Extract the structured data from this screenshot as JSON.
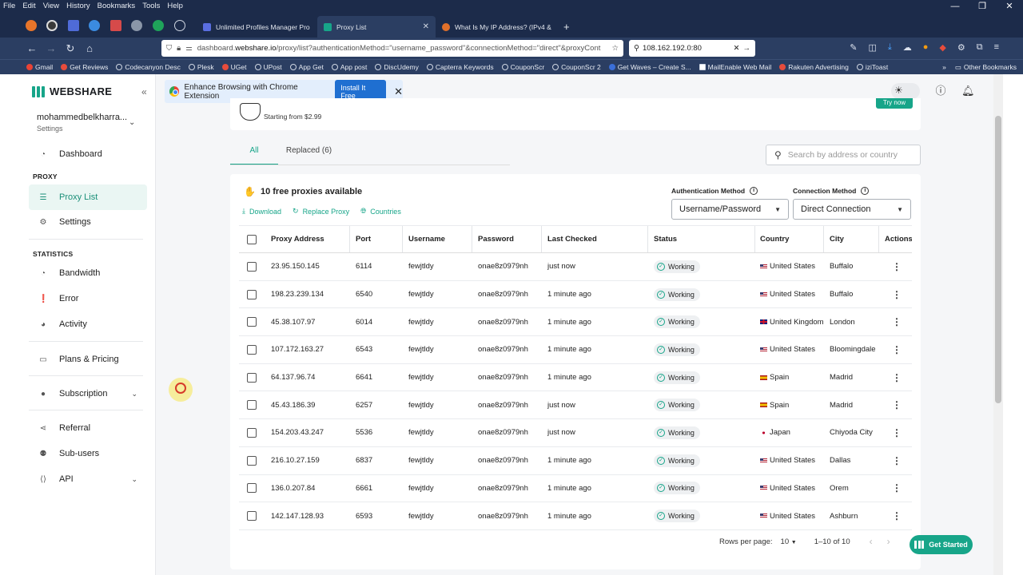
{
  "menubar": {
    "items": [
      "File",
      "Edit",
      "View",
      "History",
      "Bookmarks",
      "Tools",
      "Help"
    ]
  },
  "tabs": [
    {
      "title": "Unlimited Profiles Manager Pro",
      "active": false
    },
    {
      "title": "Proxy List",
      "active": true
    },
    {
      "title": "What Is My IP Address? (IPv4 &",
      "active": false
    }
  ],
  "newtab": "+",
  "url": {
    "prefix": "dashboard.",
    "domain": "webshare.io",
    "path": "/proxy/list?authenticationMethod=\"username_password\"&connectionMethod=\"direct\"&proxyCont"
  },
  "searchbar": {
    "value": "108.162.192.0:80"
  },
  "bookmarks": [
    "Gmail",
    "Get Reviews",
    "Codecanyon Desc",
    "Plesk",
    "UGet",
    "UPost",
    "App Get",
    "App post",
    "DiscUdemy",
    "Capterra Keywords",
    "CouponScr",
    "CouponScr 2",
    "Get Waves – Create S...",
    "MailEnable Web Mail",
    "Rakuten Advertising",
    "iziToast"
  ],
  "other_bookmarks": "Other Bookmarks",
  "app": {
    "logo": "WEBSHARE",
    "account_name": "mohammedbelkharra...",
    "account_sub": "Settings",
    "sections": {
      "proxy": "PROXY",
      "statistics": "STATISTICS"
    },
    "nav": {
      "dashboard": "Dashboard",
      "proxy_list": "Proxy List",
      "settings": "Settings",
      "bandwidth": "Bandwidth",
      "error": "Error",
      "activity": "Activity",
      "plans": "Plans & Pricing",
      "subscription": "Subscription",
      "referral": "Referral",
      "subusers": "Sub-users",
      "api": "API"
    }
  },
  "banner": {
    "text": "Enhance Browsing with Chrome Extension",
    "button": "Install It Free"
  },
  "promo": {
    "price": "Starting from $2.99",
    "button": "Try now"
  },
  "page_tabs": {
    "all": "All",
    "replaced": "Replaced (6)"
  },
  "search": {
    "placeholder": "Search by address or country"
  },
  "free_header": "10 free proxies available",
  "actions": {
    "download": "Download",
    "replace": "Replace Proxy",
    "countries": "Countries"
  },
  "auth": {
    "label": "Authentication Method",
    "value": "Username/Password"
  },
  "conn": {
    "label": "Connection Method",
    "value": "Direct Connection"
  },
  "columns": [
    "Proxy Address",
    "Port",
    "Username",
    "Password",
    "Last Checked",
    "Status",
    "Country",
    "City",
    "Actions"
  ],
  "rows": [
    {
      "addr": "23.95.150.145",
      "port": "6114",
      "user": "fewjtldy",
      "pass": "onae8z0979nh",
      "checked": "just now",
      "status": "Working",
      "country": "United States",
      "flag": "us",
      "city": "Buffalo"
    },
    {
      "addr": "198.23.239.134",
      "port": "6540",
      "user": "fewjtldy",
      "pass": "onae8z0979nh",
      "checked": "1 minute ago",
      "status": "Working",
      "country": "United States",
      "flag": "us",
      "city": "Buffalo"
    },
    {
      "addr": "45.38.107.97",
      "port": "6014",
      "user": "fewjtldy",
      "pass": "onae8z0979nh",
      "checked": "1 minute ago",
      "status": "Working",
      "country": "United Kingdom",
      "flag": "uk",
      "city": "London"
    },
    {
      "addr": "107.172.163.27",
      "port": "6543",
      "user": "fewjtldy",
      "pass": "onae8z0979nh",
      "checked": "1 minute ago",
      "status": "Working",
      "country": "United States",
      "flag": "us",
      "city": "Bloomingdale"
    },
    {
      "addr": "64.137.96.74",
      "port": "6641",
      "user": "fewjtldy",
      "pass": "onae8z0979nh",
      "checked": "1 minute ago",
      "status": "Working",
      "country": "Spain",
      "flag": "es",
      "city": "Madrid"
    },
    {
      "addr": "45.43.186.39",
      "port": "6257",
      "user": "fewjtldy",
      "pass": "onae8z0979nh",
      "checked": "just now",
      "status": "Working",
      "country": "Spain",
      "flag": "es",
      "city": "Madrid"
    },
    {
      "addr": "154.203.43.247",
      "port": "5536",
      "user": "fewjtldy",
      "pass": "onae8z0979nh",
      "checked": "just now",
      "status": "Working",
      "country": "Japan",
      "flag": "jp",
      "city": "Chiyoda City"
    },
    {
      "addr": "216.10.27.159",
      "port": "6837",
      "user": "fewjtldy",
      "pass": "onae8z0979nh",
      "checked": "1 minute ago",
      "status": "Working",
      "country": "United States",
      "flag": "us",
      "city": "Dallas"
    },
    {
      "addr": "136.0.207.84",
      "port": "6661",
      "user": "fewjtldy",
      "pass": "onae8z0979nh",
      "checked": "1 minute ago",
      "status": "Working",
      "country": "United States",
      "flag": "us",
      "city": "Orem"
    },
    {
      "addr": "142.147.128.93",
      "port": "6593",
      "user": "fewjtldy",
      "pass": "onae8z0979nh",
      "checked": "1 minute ago",
      "status": "Working",
      "country": "United States",
      "flag": "us",
      "city": "Ashburn"
    }
  ],
  "pager": {
    "label": "Rows per page:",
    "value": "10",
    "range": "1–10 of 10"
  },
  "get_started": "Get Started",
  "colors": {
    "accent": "#17a589",
    "browser_dark": "#1c2b4a",
    "browser_bar": "#2b3e62",
    "banner": "#e3eefc"
  }
}
